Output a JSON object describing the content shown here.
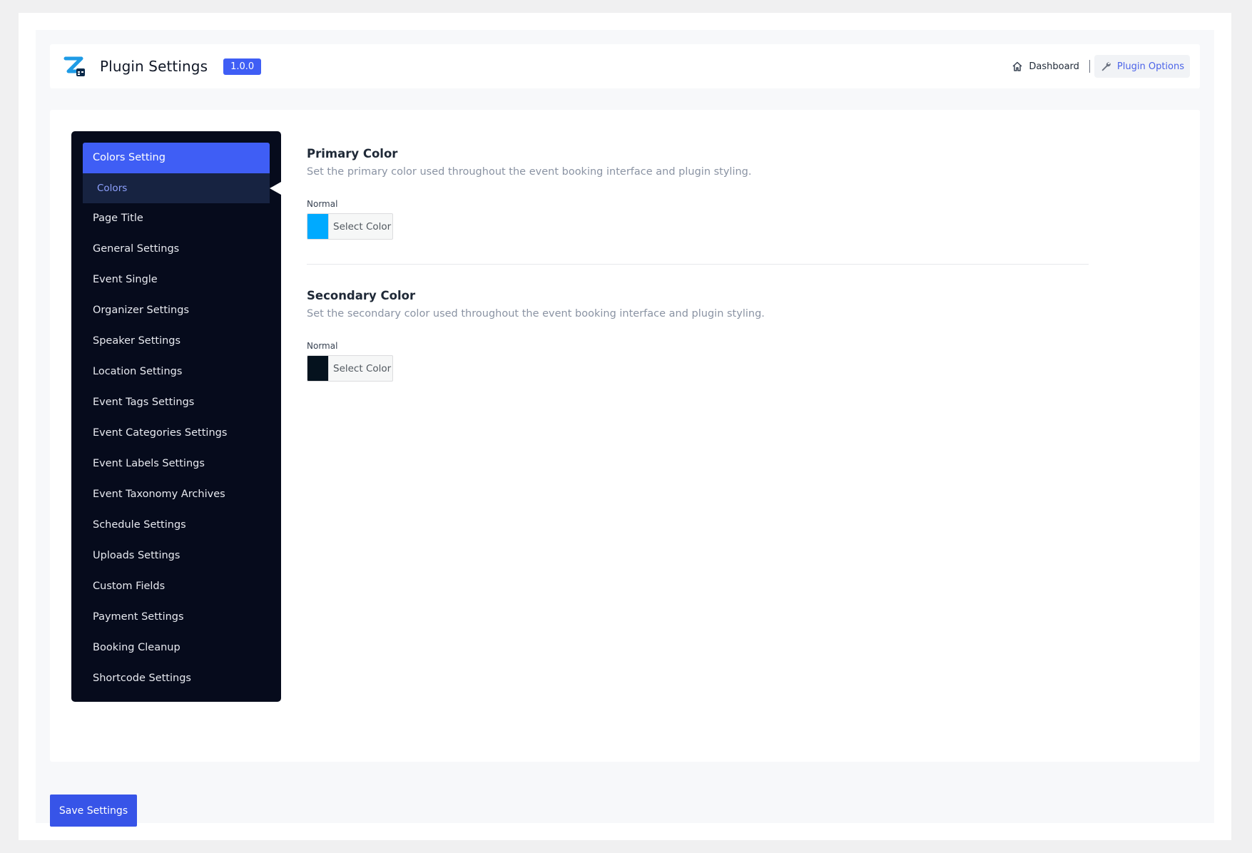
{
  "header": {
    "title": "Plugin Settings",
    "version": "1.0.0",
    "nav": {
      "dashboard": "Dashboard",
      "plugin_options": "Plugin Options"
    }
  },
  "sidebar": {
    "group_head": "Colors Setting",
    "active_sub": "Colors",
    "items": [
      "Page Title",
      "General Settings",
      "Event Single",
      "Organizer Settings",
      "Speaker Settings",
      "Location Settings",
      "Event Tags Settings",
      "Event Categories Settings",
      "Event Labels Settings",
      "Event Taxonomy Archives",
      "Schedule Settings",
      "Uploads Settings",
      "Custom Fields",
      "Payment Settings",
      "Booking Cleanup",
      "Shortcode Settings"
    ]
  },
  "sections": {
    "primary": {
      "title": "Primary Color",
      "description": "Set the primary color used throughout the event booking interface and plugin styling.",
      "label": "Normal",
      "button": "Select Color",
      "color": "#00aaff"
    },
    "secondary": {
      "title": "Secondary Color",
      "description": "Set the secondary color used throughout the event booking interface and plugin styling.",
      "label": "Normal",
      "button": "Select Color",
      "color": "#05121e"
    }
  },
  "footer": {
    "save_label": "Save Settings"
  },
  "colors": {
    "accent": "#3f5ef5",
    "sidebar_bg": "#060b1c",
    "sidebar_sub_bg": "#172341"
  }
}
